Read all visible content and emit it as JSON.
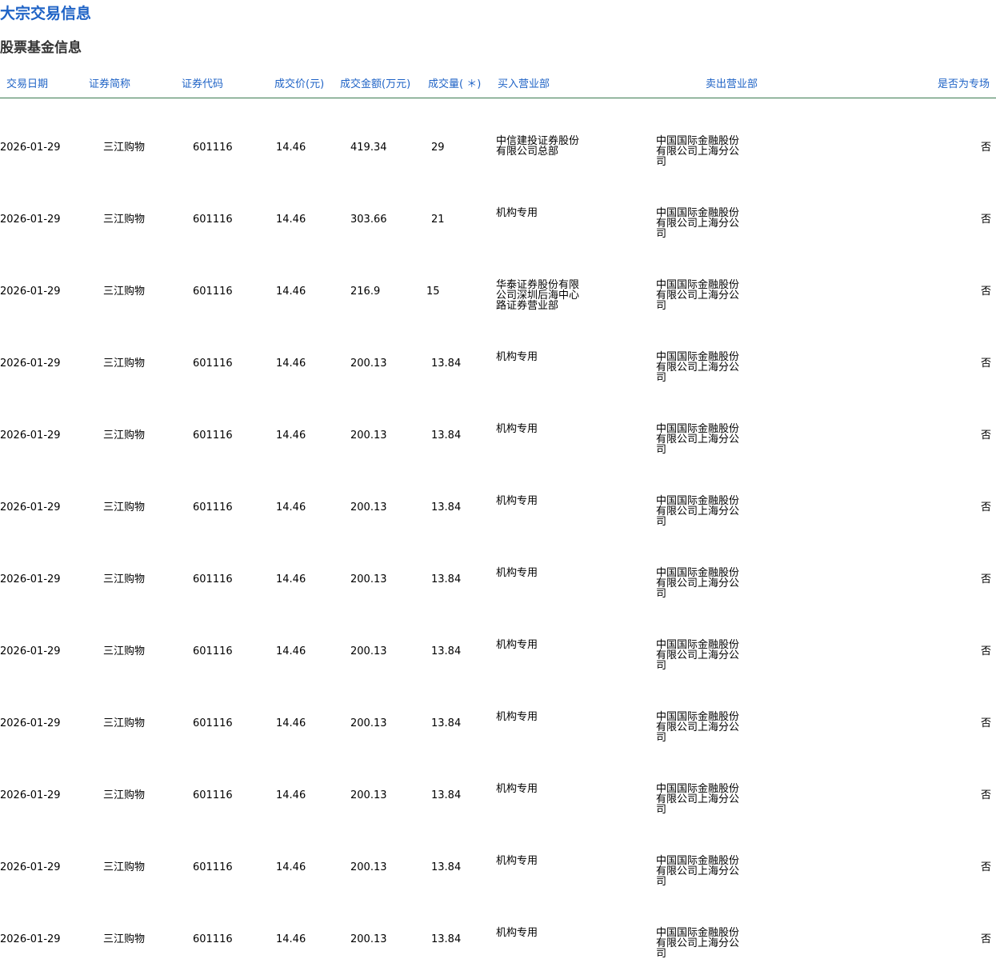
{
  "page": {
    "title": "大宗交易信息",
    "section_title": "股票基金信息"
  },
  "table": {
    "headers": {
      "date": "交易日期",
      "name": "证券简称",
      "code": "证券代码",
      "price": "成交价(元)",
      "amount": "成交金额(万元)",
      "volume": "成交量( ＊)",
      "buyer": "买入营业部",
      "seller": "卖出营业部",
      "special": "是否为专场"
    },
    "rows": [
      {
        "date": "2026-01-29",
        "name": "三江购物",
        "code": "601116",
        "price": "14.46",
        "amount": "419.34",
        "volume": "29",
        "buyer": "中信建投证券股份有限公司总部",
        "seller": "中国国际金融股份有限公司上海分公司",
        "special": "否"
      },
      {
        "date": "2026-01-29",
        "name": "三江购物",
        "code": "601116",
        "price": "14.46",
        "amount": "303.66",
        "volume": "21",
        "buyer": "机构专用",
        "seller": "中国国际金融股份有限公司上海分公司",
        "special": "否"
      },
      {
        "date": "2026-01-29",
        "name": "三江购物",
        "code": "601116",
        "price": "14.46",
        "amount": "216.9",
        "volume": "15",
        "buyer": "华泰证券股份有限公司深圳后海中心路证券营业部",
        "seller": "中国国际金融股份有限公司上海分公司",
        "special": "否"
      },
      {
        "date": "2026-01-29",
        "name": "三江购物",
        "code": "601116",
        "price": "14.46",
        "amount": "200.13",
        "volume": "13.84",
        "buyer": "机构专用",
        "seller": "中国国际金融股份有限公司上海分公司",
        "special": "否"
      },
      {
        "date": "2026-01-29",
        "name": "三江购物",
        "code": "601116",
        "price": "14.46",
        "amount": "200.13",
        "volume": "13.84",
        "buyer": "机构专用",
        "seller": "中国国际金融股份有限公司上海分公司",
        "special": "否"
      },
      {
        "date": "2026-01-29",
        "name": "三江购物",
        "code": "601116",
        "price": "14.46",
        "amount": "200.13",
        "volume": "13.84",
        "buyer": "机构专用",
        "seller": "中国国际金融股份有限公司上海分公司",
        "special": "否"
      },
      {
        "date": "2026-01-29",
        "name": "三江购物",
        "code": "601116",
        "price": "14.46",
        "amount": "200.13",
        "volume": "13.84",
        "buyer": "机构专用",
        "seller": "中国国际金融股份有限公司上海分公司",
        "special": "否"
      },
      {
        "date": "2026-01-29",
        "name": "三江购物",
        "code": "601116",
        "price": "14.46",
        "amount": "200.13",
        "volume": "13.84",
        "buyer": "机构专用",
        "seller": "中国国际金融股份有限公司上海分公司",
        "special": "否"
      },
      {
        "date": "2026-01-29",
        "name": "三江购物",
        "code": "601116",
        "price": "14.46",
        "amount": "200.13",
        "volume": "13.84",
        "buyer": "机构专用",
        "seller": "中国国际金融股份有限公司上海分公司",
        "special": "否"
      },
      {
        "date": "2026-01-29",
        "name": "三江购物",
        "code": "601116",
        "price": "14.46",
        "amount": "200.13",
        "volume": "13.84",
        "buyer": "机构专用",
        "seller": "中国国际金融股份有限公司上海分公司",
        "special": "否"
      },
      {
        "date": "2026-01-29",
        "name": "三江购物",
        "code": "601116",
        "price": "14.46",
        "amount": "200.13",
        "volume": "13.84",
        "buyer": "机构专用",
        "seller": "中国国际金融股份有限公司上海分公司",
        "special": "否"
      },
      {
        "date": "2026-01-29",
        "name": "三江购物",
        "code": "601116",
        "price": "14.46",
        "amount": "200.13",
        "volume": "13.84",
        "buyer": "机构专用",
        "seller": "中国国际金融股份有限公司上海分公司",
        "special": "否"
      }
    ]
  }
}
